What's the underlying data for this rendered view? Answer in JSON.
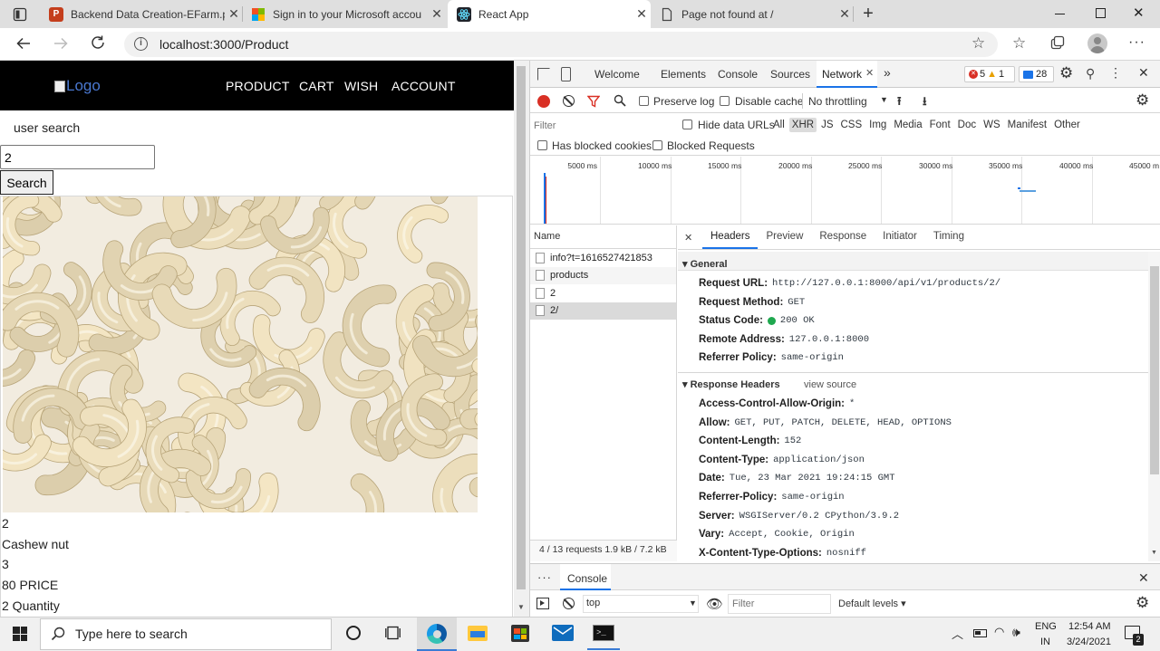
{
  "browser": {
    "tabs": [
      {
        "label": "Backend Data Creation-EFarm.pp",
        "icon": "powerpoint-icon"
      },
      {
        "label": "Sign in to your Microsoft accou",
        "icon": "microsoft-icon"
      },
      {
        "label": "React App",
        "icon": "react-icon"
      },
      {
        "label": "Page not found at /",
        "icon": "page-icon"
      }
    ],
    "url": "localhost:3000/Product"
  },
  "page": {
    "logo_alt": "Logo",
    "nav": [
      "PRODUCT",
      "CART",
      "WISH",
      "ACCOUNT"
    ],
    "search_label": "user search",
    "search_value": "2",
    "search_button": "Search",
    "product": {
      "id": "2",
      "name": "Cashew nut",
      "line3": "3",
      "price": "80 PRICE",
      "quantity": "2 Quantity"
    }
  },
  "devtools": {
    "tabs": [
      "Welcome",
      "Elements",
      "Console",
      "Sources",
      "Network"
    ],
    "errors": "5",
    "warnings": "1",
    "messages": "28",
    "toolbar": {
      "preserve_log": "Preserve log",
      "disable_cache": "Disable cache",
      "throttle": "No throttling"
    },
    "filter_placeholder": "Filter",
    "hide_data_urls": "Hide data URLs",
    "types": [
      "All",
      "XHR",
      "JS",
      "CSS",
      "Img",
      "Media",
      "Font",
      "Doc",
      "WS",
      "Manifest",
      "Other"
    ],
    "blocked_cookies": "Has blocked cookies",
    "blocked_requests": "Blocked Requests",
    "timeline_ticks": [
      "5000 ms",
      "10000 ms",
      "15000 ms",
      "20000 ms",
      "25000 ms",
      "30000 ms",
      "35000 ms",
      "40000 ms",
      "45000 m"
    ],
    "name_header": "Name",
    "requests": [
      "info?t=1616527421853",
      "products",
      "2",
      "2/"
    ],
    "summary": "4 / 13 requests  1.9 kB / 7.2 kB",
    "detail_tabs": [
      "Headers",
      "Preview",
      "Response",
      "Initiator",
      "Timing"
    ],
    "general_title": "General",
    "general": [
      {
        "k": "Request URL:",
        "v": "http://127.0.0.1:8000/api/v1/products/2/"
      },
      {
        "k": "Request Method:",
        "v": "GET"
      },
      {
        "k": "Status Code:",
        "v": "200 OK"
      },
      {
        "k": "Remote Address:",
        "v": "127.0.0.1:8000"
      },
      {
        "k": "Referrer Policy:",
        "v": "same-origin"
      }
    ],
    "response_title": "Response Headers",
    "view_source": "view source",
    "response": [
      {
        "k": "Access-Control-Allow-Origin:",
        "v": "*"
      },
      {
        "k": "Allow:",
        "v": "GET, PUT, PATCH, DELETE, HEAD, OPTIONS"
      },
      {
        "k": "Content-Length:",
        "v": "152"
      },
      {
        "k": "Content-Type:",
        "v": "application/json"
      },
      {
        "k": "Date:",
        "v": "Tue, 23 Mar 2021 19:24:15 GMT"
      },
      {
        "k": "Referrer-Policy:",
        "v": "same-origin"
      },
      {
        "k": "Server:",
        "v": "WSGIServer/0.2 CPython/3.9.2"
      },
      {
        "k": "Vary:",
        "v": "Accept, Cookie, Origin"
      },
      {
        "k": "X-Content-Type-Options:",
        "v": "nosniff"
      }
    ],
    "drawer_tab": "Console",
    "context": "top",
    "console_filter": "Filter",
    "levels": "Default levels ▾"
  },
  "taskbar": {
    "search_placeholder": "Type here to search",
    "lang1": "ENG",
    "lang2": "IN",
    "time": "12:54 AM",
    "date": "3/24/2021",
    "notifications": "2"
  }
}
